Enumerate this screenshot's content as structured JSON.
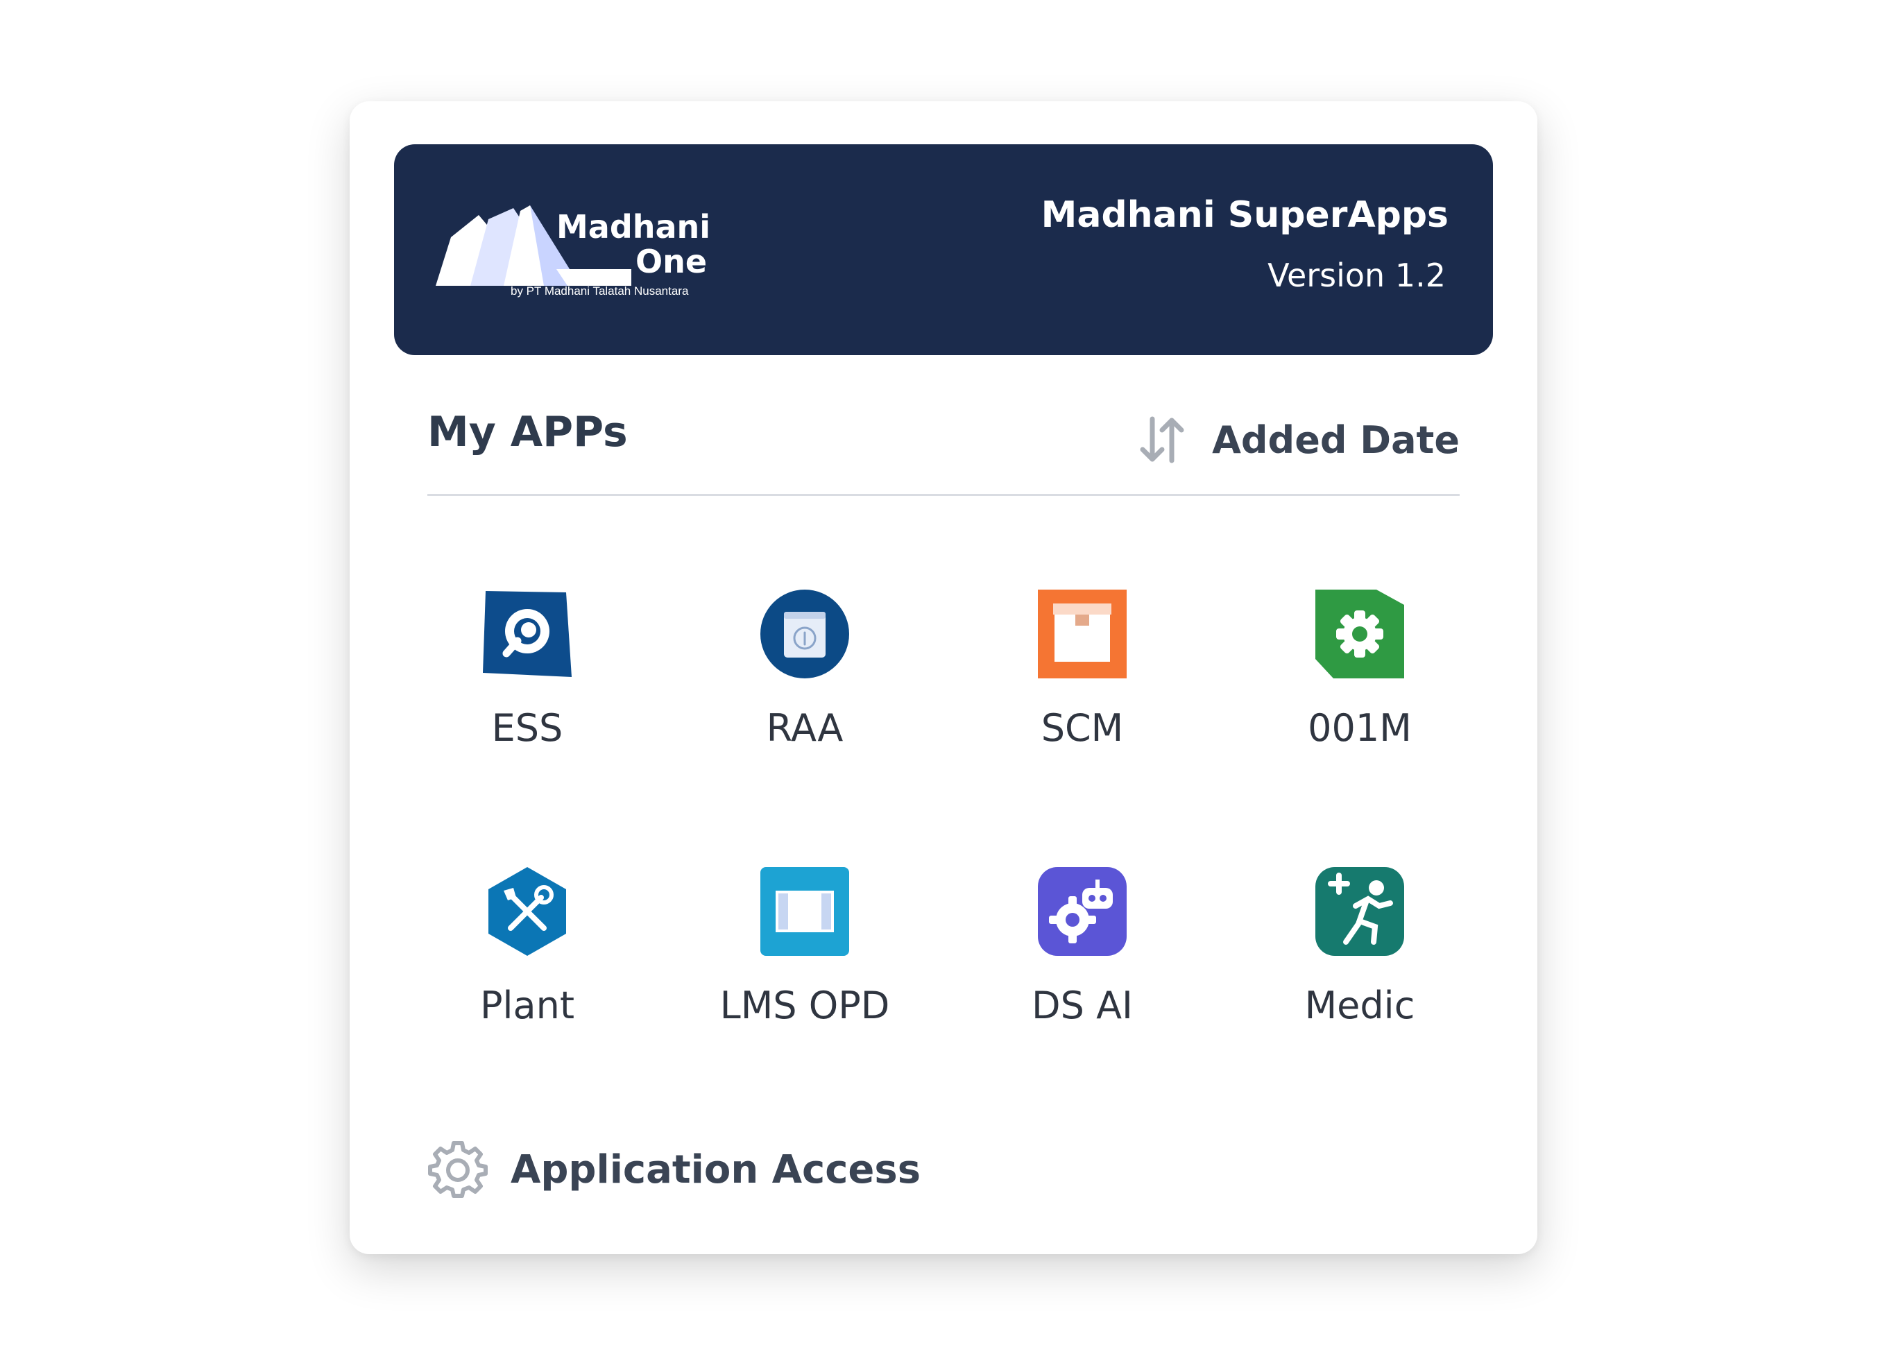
{
  "banner": {
    "logo": {
      "line1": "Madhani",
      "line2": "One",
      "by": "by PT Madhani Talatah Nusantara"
    },
    "title": "Madhani SuperApps",
    "version": "Version 1.2"
  },
  "section": {
    "title": "My APPs",
    "sort_label": "Added Date"
  },
  "apps": [
    {
      "label": "ESS",
      "icon": "search-doc-icon",
      "color": "#0d4c8c"
    },
    {
      "label": "RAA",
      "icon": "document-circle-icon",
      "color": "#0c4a86"
    },
    {
      "label": "SCM",
      "icon": "box-icon",
      "color": "#f57533"
    },
    {
      "label": "001M",
      "icon": "gear-tag-icon",
      "color": "#2f9a43"
    },
    {
      "label": "Plant",
      "icon": "tools-hexagon-icon",
      "color": "#0b76b5"
    },
    {
      "label": "LMS OPD",
      "icon": "book-icon",
      "color": "#1da3d3"
    },
    {
      "label": "DS AI",
      "icon": "robot-gear-icon",
      "color": "#5b55d6"
    },
    {
      "label": "Medic",
      "icon": "runner-medic-icon",
      "color": "#167a6e"
    }
  ],
  "footer": {
    "access_label": "Application Access"
  },
  "colors": {
    "banner_bg": "#1b2b4c",
    "text_primary": "#2f3b4d"
  }
}
